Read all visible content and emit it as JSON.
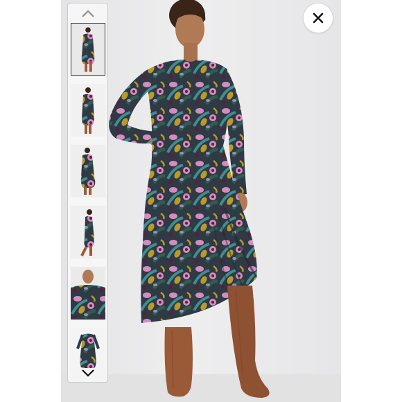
{
  "gallery": {
    "thumbnails": [
      {
        "view": "front-full",
        "selected": true
      },
      {
        "view": "back-full",
        "selected": false
      },
      {
        "view": "side-full",
        "selected": false
      },
      {
        "view": "side-walk",
        "selected": false
      },
      {
        "view": "detail-neckline",
        "selected": false
      },
      {
        "view": "flat-lay",
        "selected": false
      }
    ],
    "icons": {
      "scroll_up": "chevron-up-icon",
      "scroll_down": "chevron-down-icon",
      "close": "close-icon"
    }
  },
  "colors": {
    "dress_base": "#2f3a44",
    "dress_green": "#2f5e4e",
    "print_pink": "#d58cc0",
    "print_mustard": "#b99a2a",
    "print_teal": "#3f8e92",
    "print_plum": "#5a1f3a",
    "boots": "#9a5a38",
    "skin": "#b07a54",
    "hair": "#3a2418",
    "backdrop": "#ebebec"
  }
}
